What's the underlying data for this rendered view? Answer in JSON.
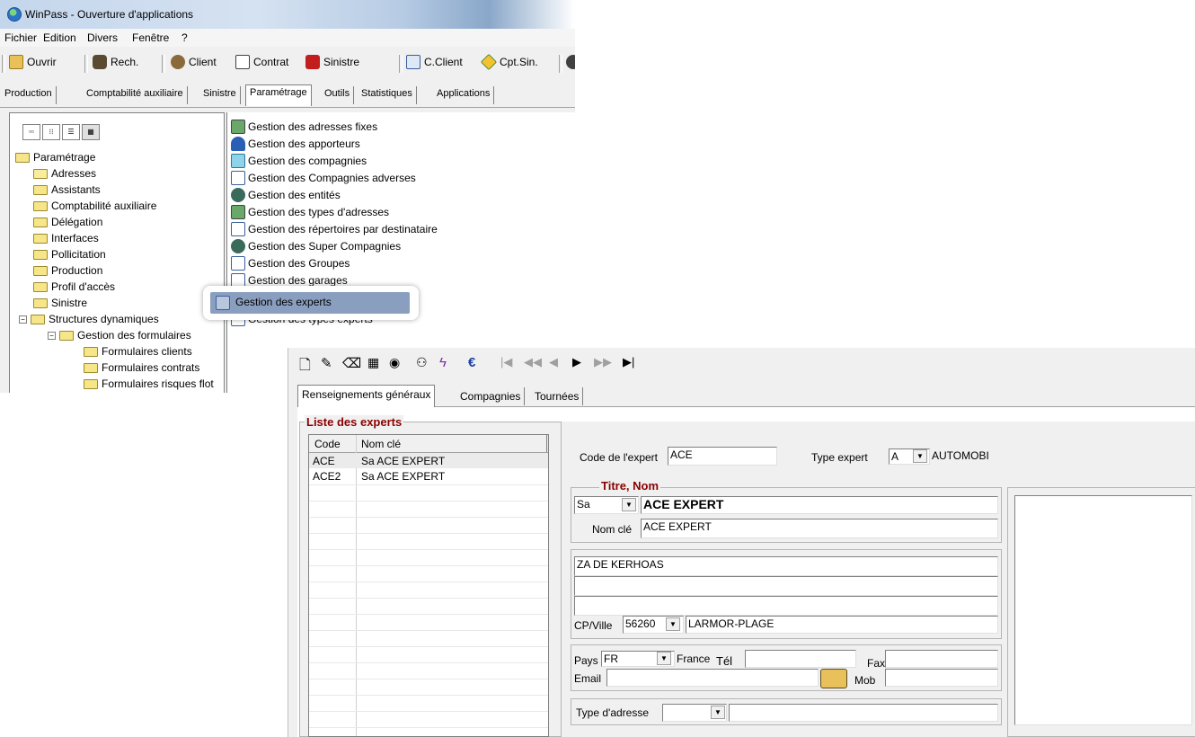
{
  "window": {
    "title": "WinPass - Ouverture d'applications",
    "menu": [
      "Fichier",
      "Edition",
      "Divers",
      "Fenêtre",
      "?"
    ],
    "toolbar": {
      "open": "Ouvrir",
      "search": "Rech.",
      "client": "Client",
      "contract": "Contrat",
      "claim": "Sinistre",
      "client_account": "C.Client",
      "claim_account": "Cpt.Sin."
    },
    "tabs": [
      "Production",
      "Comptabilité auxiliaire",
      "Sinistre",
      "Paramétrage",
      "Outils",
      "Statistiques",
      "Applications"
    ],
    "selected_tab": "Paramétrage"
  },
  "tree": {
    "root": "Paramétrage",
    "items": [
      "Adresses",
      "Assistants",
      "Comptabilité auxiliaire",
      "Délégation",
      "Interfaces",
      "Pollicitation",
      "Production",
      "Profil d'accès",
      "Sinistre",
      "Structures dynamiques"
    ],
    "sub_folder": "Gestion des formulaires",
    "sub_items": [
      "Formulaires clients",
      "Formulaires contrats",
      "Formulaires risques flot"
    ]
  },
  "list": {
    "items": [
      "Gestion des adresses fixes",
      "Gestion des apporteurs",
      "Gestion des compagnies",
      "Gestion des Compagnies adverses",
      "Gestion des entités",
      "Gestion des types d'adresses",
      "Gestion des répertoires par destinataire",
      "Gestion des Super Compagnies",
      "Gestion des Groupes",
      "Gestion des garages",
      "Gestion des experts",
      "Gestion des types experts"
    ],
    "highlighted": "Gestion des experts"
  },
  "form": {
    "tabs": [
      "Renseignements généraux",
      "Compagnies",
      "Tournées"
    ],
    "experts_group_title": "Liste des experts",
    "grid_headers": [
      "Code",
      "Nom clé"
    ],
    "grid_rows": [
      [
        "ACE",
        "Sa ACE EXPERT"
      ],
      [
        "ACE2",
        "Sa ACE EXPERT"
      ]
    ],
    "code_label": "Code de l'expert",
    "code_value": "ACE",
    "type_label": "Type expert",
    "type_code": "A",
    "type_value": "AUTOMOBI",
    "titre_nom_title": "Titre,  Nom",
    "titre_value": "Sa",
    "nom_value": "ACE EXPERT",
    "nomcle_label": "Nom clé",
    "nomcle_value": "ACE EXPERT",
    "address_line1": "ZA DE KERHOAS",
    "address_line2": "",
    "address_line3": "",
    "cpville_label": "CP/Ville",
    "cp_value": "56260",
    "ville_value": "LARMOR-PLAGE",
    "pays_label": "Pays",
    "pays_value": "FR",
    "pays_name": "France",
    "tel_label": "Tél",
    "fax_label": "Fax",
    "email_label": "Email",
    "mob_label": "Mob",
    "type_adresse_label": "Type d'adresse"
  },
  "colors": {
    "group_title": "#8b0000",
    "selection_highlight": "#8a9fc0"
  }
}
